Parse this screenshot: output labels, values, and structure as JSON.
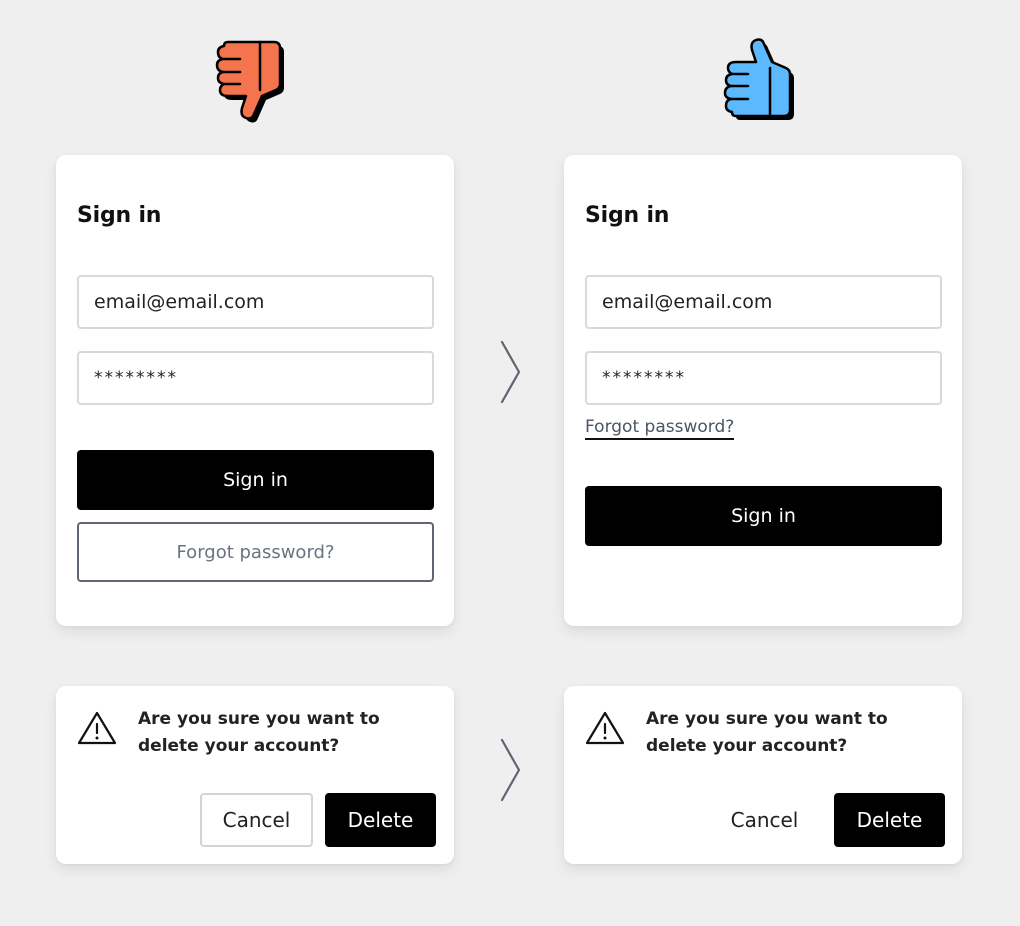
{
  "colors": {
    "bad_icon": "#f4744e",
    "good_icon": "#5cb8ff",
    "arrow": "#5f6673",
    "background": "#efefef"
  },
  "icons": {
    "bad": "thumbs-down-icon",
    "good": "thumbs-up-icon",
    "divider": "chevron-right-icon",
    "warning": "warning-triangle-icon"
  },
  "bad_example": {
    "signin": {
      "title": "Sign in",
      "email_value": "email@email.com",
      "password_value": "********",
      "submit_label": "Sign in",
      "forgot_label": "Forgot password?"
    },
    "dialog": {
      "message": "Are you sure you want to delete your account?",
      "cancel_label": "Cancel",
      "delete_label": "Delete"
    }
  },
  "good_example": {
    "signin": {
      "title": "Sign in",
      "email_value": "email@email.com",
      "password_value": "********",
      "forgot_label": "Forgot password?",
      "submit_label": "Sign in"
    },
    "dialog": {
      "message": "Are you sure you want to delete your account?",
      "cancel_label": "Cancel",
      "delete_label": "Delete"
    }
  }
}
